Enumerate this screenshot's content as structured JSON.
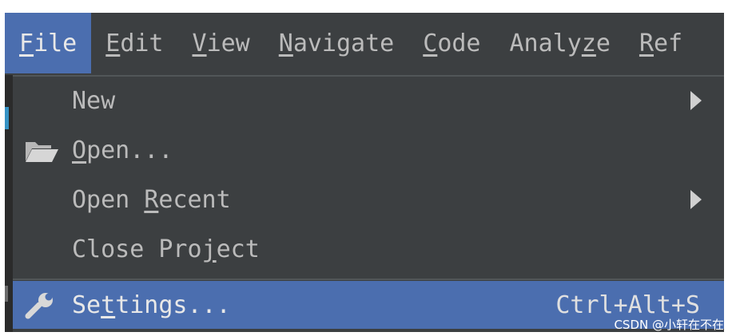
{
  "menubar": {
    "items": [
      {
        "label_mn": "F",
        "label_rest": "ile"
      },
      {
        "label_mn": "E",
        "label_rest": "dit"
      },
      {
        "label_mn": "V",
        "label_rest": "iew"
      },
      {
        "label_mn": "N",
        "label_rest": "avigate"
      },
      {
        "label_mn": "C",
        "label_rest": "ode"
      },
      {
        "label_pre": "Analy",
        "label_mn": "z",
        "label_rest": "e"
      },
      {
        "label_mn": "R",
        "label_rest": "ef"
      }
    ]
  },
  "file_menu": {
    "new": {
      "label": "New"
    },
    "open": {
      "mn": "O",
      "rest": "pen...",
      "icon": "folder-open-icon"
    },
    "open_recent": {
      "pre": "Open ",
      "mn": "R",
      "rest": "ecent"
    },
    "close_project": {
      "pre": "Close Pro",
      "mn": "j",
      "rest": "ect"
    },
    "settings": {
      "pre": "Se",
      "mn": "t",
      "rest": "tings...",
      "shortcut": "Ctrl+Alt+S",
      "icon": "wrench-icon"
    }
  },
  "colors": {
    "background": "#3c3f41",
    "accent": "#4b6eaf",
    "text": "#bbbbbb"
  },
  "watermark": "CSDN @小轩在不在哟"
}
